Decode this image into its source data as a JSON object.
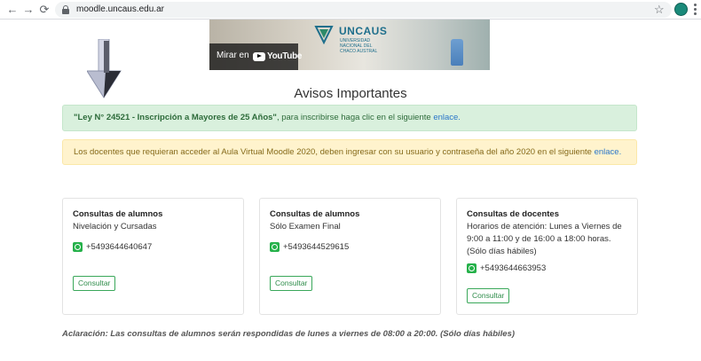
{
  "browser": {
    "url": "moodle.uncaus.edu.ar",
    "back_icon": "←",
    "forward_icon": "→",
    "reload_icon": "⟳",
    "star_icon": "☆"
  },
  "video": {
    "watch_label": "Mirar en",
    "youtube_label": "YouTube",
    "uni_name": "UNCAUS",
    "uni_sub": "Universidad Nacional del Chaco Austral"
  },
  "heading": "Avisos Importantes",
  "alerts": {
    "green": {
      "bold": "\"Ley N° 24521 - Inscripción a Mayores de 25 Años\"",
      "text": ", para inscribirse haga clic en el siguiente ",
      "link": "enlace."
    },
    "yellow": {
      "text": "Los docentes que requieran acceder al Aula Virtual Moodle 2020, deben ingresar con su usuario y contraseña del año 2020 en el siguiente ",
      "link": "enlace."
    }
  },
  "cards": [
    {
      "title": "Consultas de alumnos",
      "subtitle": "Nivelación y Cursadas",
      "phone": "+5493644640647",
      "button": "Consultar"
    },
    {
      "title": "Consultas de alumnos",
      "subtitle": "Sólo Examen Final",
      "phone": "+5493644529615",
      "button": "Consultar"
    },
    {
      "title": "Consultas de docentes",
      "subtitle": "Horarios de atención: Lunes a Viernes de 9:00 a 11:00 y de 16:00 a 18:00 horas. (Sólo días hábiles)",
      "phone": "+5493644663953",
      "button": "Consultar"
    }
  ],
  "note": "Aclaración: Las consultas de alumnos serán respondidas de lunes a viernes de 08:00 a 20:00. (Sólo días hábiles)",
  "colors": {
    "success_bg": "#d9f0dd",
    "warning_bg": "#fff3cd",
    "link": "#2a76c9",
    "button_green": "#3aa85a"
  }
}
